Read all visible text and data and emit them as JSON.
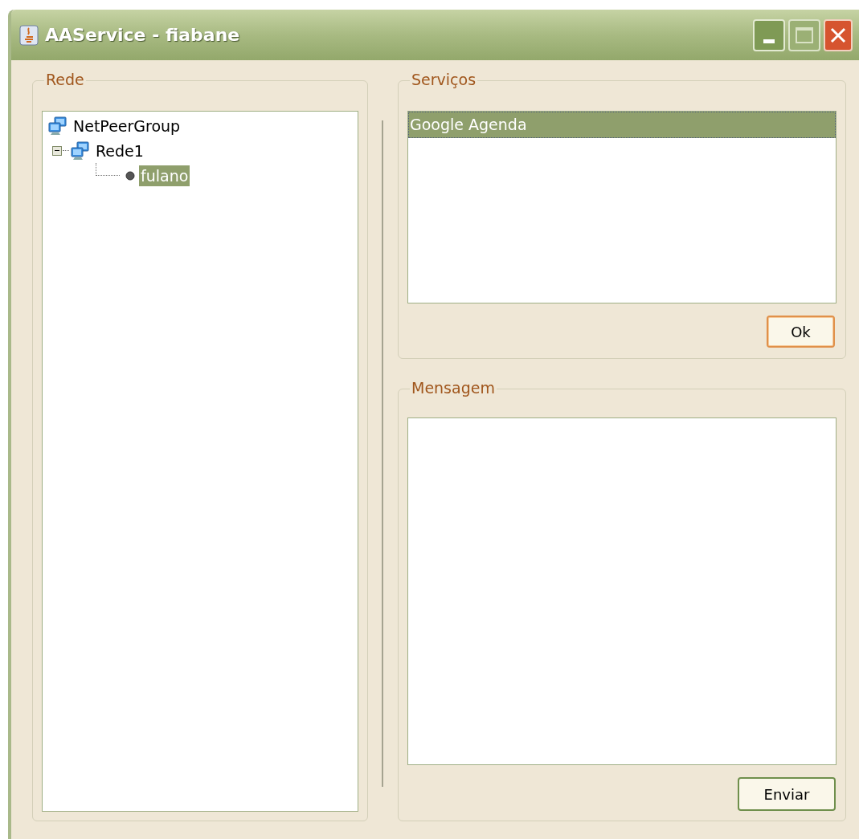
{
  "window": {
    "title": "AAService - fiabane"
  },
  "network_panel": {
    "title": "Rede",
    "tree": [
      {
        "label": "NetPeerGroup",
        "kind": "group",
        "selected": false,
        "children": [
          {
            "label": "Rede1",
            "kind": "group",
            "selected": false,
            "expanded": true,
            "children": [
              {
                "label": "fulano",
                "kind": "peer",
                "selected": true
              }
            ]
          }
        ]
      }
    ]
  },
  "services_panel": {
    "title": "Serviços",
    "items": [
      {
        "label": "Google Agenda",
        "selected": true
      }
    ],
    "button": {
      "label": "Ok",
      "focused": true
    }
  },
  "message_panel": {
    "title": "Mensagem",
    "button": {
      "label": "Enviar",
      "focused": false
    }
  }
}
